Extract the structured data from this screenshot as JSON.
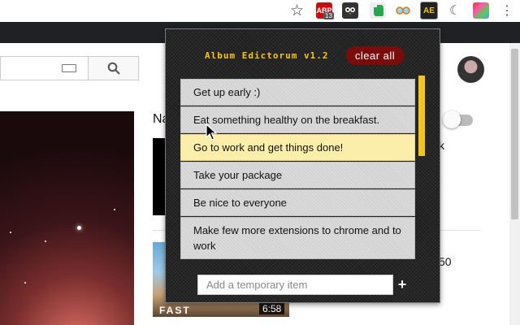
{
  "browser": {
    "abp_label": "ABP",
    "abp_count": "13",
    "ae_label": "AE",
    "star_glyph": "☆",
    "menu_glyph": "⋮",
    "extensions": [
      "adblock-plus-icon",
      "owl-icon",
      "evernote-icon",
      "glasses-icon",
      "album-edictorum-icon",
      "moon-icon",
      "color-picker-icon"
    ]
  },
  "page": {
    "search_glyph": "⌕",
    "na_text": "Na",
    "k_text": "k",
    "video_brand": "FAST",
    "video_duration": "6:58",
    "side_text": "50"
  },
  "popup": {
    "title": "Album Edictorum v1.2",
    "clear_label": "clear all",
    "items": [
      {
        "text": "Get up early :)",
        "highlighted": false
      },
      {
        "text": "Eat something healthy on the breakfast.",
        "highlighted": false
      },
      {
        "text": "Go to work and get things done!",
        "highlighted": true
      },
      {
        "text": "Take your package",
        "highlighted": false
      },
      {
        "text": "Be nice to everyone",
        "highlighted": false
      },
      {
        "text": "Make few more extensions to chrome and to work",
        "highlighted": false
      }
    ],
    "input_placeholder": "Add a temporary item",
    "add_label": "+",
    "accent_color": "#f5c518",
    "clear_color": "#7a0c0c"
  }
}
